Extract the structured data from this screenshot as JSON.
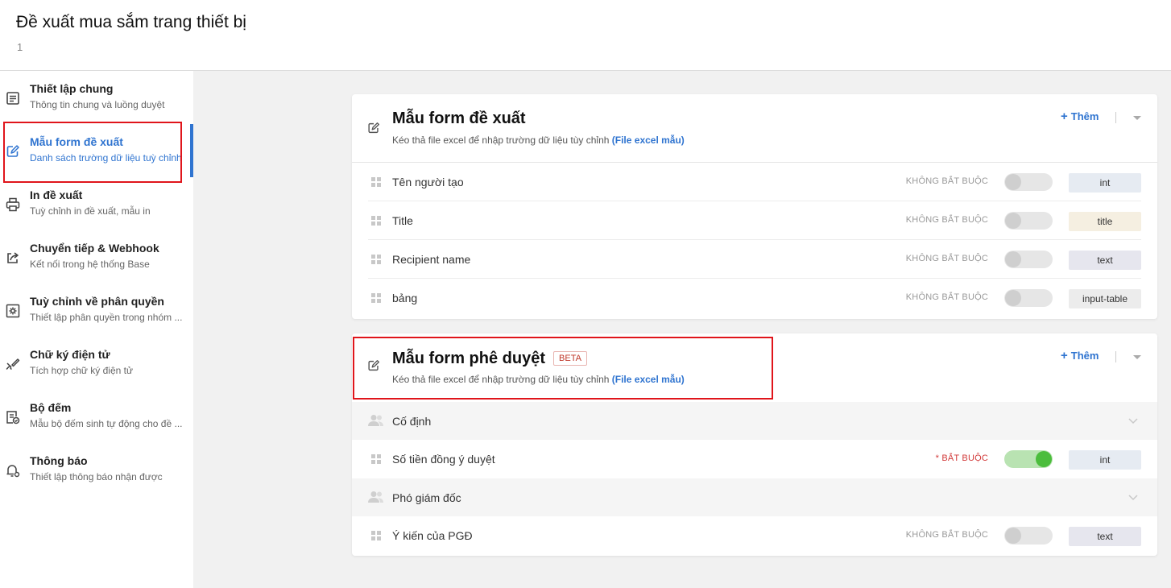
{
  "header": {
    "title": "Đề xuất mua sắm trang thiết bị",
    "subtitle": "1"
  },
  "sidebar": {
    "items": [
      {
        "title": "Thiết lập chung",
        "desc": "Thông tin chung và luồng duyệt",
        "icon": "document-icon"
      },
      {
        "title": "Mẫu form đề xuất",
        "desc": "Danh sách trường dữ liệu tuỳ chỉnh",
        "icon": "edit-icon",
        "active": true
      },
      {
        "title": "In đề xuất",
        "desc": "Tuỳ chỉnh in đề xuất, mẫu in",
        "icon": "printer-icon"
      },
      {
        "title": "Chuyển tiếp & Webhook",
        "desc": "Kết nối trong hệ thống Base",
        "icon": "share-icon"
      },
      {
        "title": "Tuỳ chỉnh về phân quyền",
        "desc": "Thiết lập phân quyền trong nhóm ...",
        "icon": "gear-box-icon"
      },
      {
        "title": "Chữ ký điện tử",
        "desc": "Tích hợp chữ ký điện tử",
        "icon": "signature-icon"
      },
      {
        "title": "Bộ đếm",
        "desc": "Mẫu bộ đếm sinh tự động cho đề ...",
        "icon": "counter-icon"
      },
      {
        "title": "Thông báo",
        "desc": "Thiết lập thông báo nhận được",
        "icon": "bell-gear-icon"
      }
    ]
  },
  "colors": {
    "accent": "#2f74d0",
    "highlight": "#e0151b",
    "toggle_on": "#4bbd3c"
  },
  "proposal_form": {
    "title": "Mẫu form đề xuất",
    "desc_text": "Kéo thả file excel để nhập trường dữ liệu tùy chỉnh ",
    "desc_link": "(File excel mẫu)",
    "add_label": "Thêm",
    "add_plus": "+",
    "fields": [
      {
        "label": "Tên người tạo",
        "required_text": "KHÔNG BẮT BUỘC",
        "required": false,
        "type": "int",
        "type_bg": "#e6ebf2"
      },
      {
        "label": "Title",
        "required_text": "KHÔNG BẮT BUỘC",
        "required": false,
        "type": "title",
        "type_bg": "#f5efe1"
      },
      {
        "label": "Recipient name",
        "required_text": "KHÔNG BẮT BUỘC",
        "required": false,
        "type": "text",
        "type_bg": "#e6e6ee"
      },
      {
        "label": "bảng",
        "required_text": "KHÔNG BẮT BUỘC",
        "required": false,
        "type": "input-table",
        "type_bg": "#ececec"
      }
    ]
  },
  "approval_form": {
    "title": "Mẫu form phê duyệt",
    "badge": "BETA",
    "desc_text": "Kéo thả file excel để nhập trường dữ liệu tùy chỉnh ",
    "desc_link": "(File excel mẫu)",
    "add_label": "Thêm",
    "add_plus": "+",
    "groups": [
      {
        "label": "Cố định",
        "fields": [
          {
            "label": "Số tiền đồng ý duyệt",
            "required_text": "* BẮT BUỘC",
            "required": true,
            "type": "int",
            "type_bg": "#e6ebf2"
          }
        ]
      },
      {
        "label": "Phó giám đốc",
        "fields": [
          {
            "label": "Ý kiến của PGĐ",
            "required_text": "KHÔNG BẮT BUỘC",
            "required": false,
            "type": "text",
            "type_bg": "#e6e6ee"
          }
        ]
      }
    ]
  }
}
